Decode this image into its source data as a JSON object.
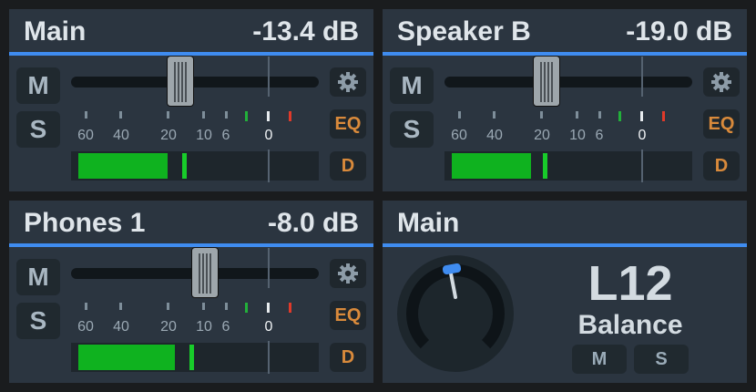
{
  "colors": {
    "accent": "#3f8cf0",
    "panel_bg": "#2b3540",
    "meter_green": "#0fb21f",
    "eq_orange": "#d98a3b"
  },
  "channels": [
    {
      "name": "Main",
      "gain": "-13.4 dB",
      "mute_label": "M",
      "solo_label": "S",
      "settings_icon": "gear-icon",
      "eq_label": "EQ",
      "d_label": "D",
      "fader_level": 0.44,
      "meter_level": 0.36,
      "scale": [
        "60",
        "40",
        "20",
        "10",
        "6",
        "0"
      ]
    },
    {
      "name": "Speaker B",
      "gain": "-19.0 dB",
      "mute_label": "M",
      "solo_label": "S",
      "settings_icon": "gear-icon",
      "eq_label": "EQ",
      "d_label": "D",
      "fader_level": 0.41,
      "meter_level": 0.32,
      "scale": [
        "60",
        "40",
        "20",
        "10",
        "6",
        "0"
      ]
    },
    {
      "name": "Phones 1",
      "gain": "-8.0 dB",
      "mute_label": "M",
      "solo_label": "S",
      "settings_icon": "gear-icon",
      "eq_label": "EQ",
      "d_label": "D",
      "fader_level": 0.54,
      "meter_level": 0.39,
      "scale": [
        "60",
        "40",
        "20",
        "10",
        "6",
        "0"
      ]
    }
  ],
  "balance": {
    "name": "Main",
    "value": "L12",
    "label": "Balance",
    "mute_label": "M",
    "solo_label": "S"
  }
}
